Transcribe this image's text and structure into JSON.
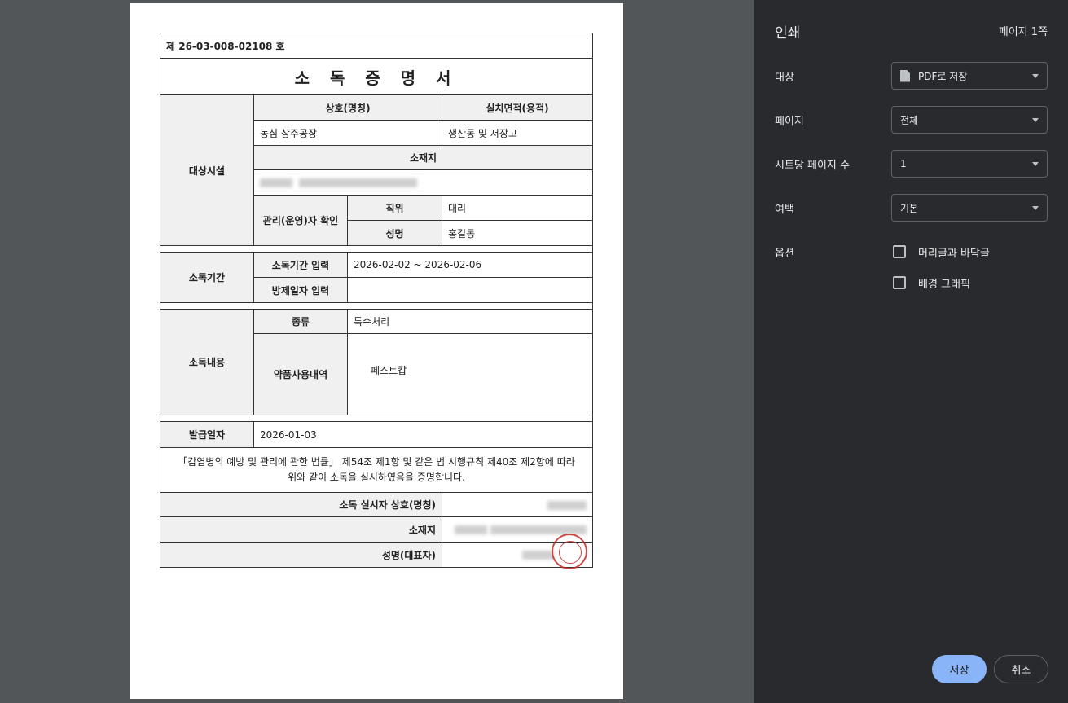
{
  "document": {
    "doc_no": "제 26-03-008-02108 호",
    "title": "소 독 증 명 서",
    "facility_label": "대상시설",
    "name_header": "상호(명칭)",
    "area_header": "실치면적(용적)",
    "name_value": "농심 상주공장",
    "area_value": "생산동 및 저장고",
    "address_header": "소재지",
    "manager_label": "관리(운영)자 확인",
    "position_label": "직위",
    "position_value": "대리",
    "person_label": "성명",
    "person_value": "홍길동",
    "period_label": "소독기간",
    "period_input_label": "소독기간 입력",
    "period_value": "2026-02-02 ~ 2026-02-06",
    "pest_date_label": "방제일자 입력",
    "pest_date_value": "",
    "content_label": "소독내용",
    "type_label": "종류",
    "type_value": "특수처리",
    "chem_label": "약품사용내역",
    "chem_value": "페스트캅",
    "issue_label": "발급일자",
    "issue_value": "2026-01-03",
    "statement_line1": "「감염병의 예방 및 관리에 관한 법률」 제54조 제1항 및 같은 법 시행규칙 제40조 제2항에 따라",
    "statement_line2": "위와 같이 소독을 실시하였음을 증명합니다.",
    "disinfector_name_label": "소독 실시자 상호(명칭)",
    "disinfector_address_label": "소재지",
    "representative_label": "성명(대표자)"
  },
  "panel": {
    "title": "인쇄",
    "page_count": "페이지 1쪽",
    "destination_label": "대상",
    "destination_value": "PDF로 저장",
    "pages_label": "페이지",
    "pages_value": "전체",
    "per_sheet_label": "시트당 페이지 수",
    "per_sheet_value": "1",
    "margins_label": "여백",
    "margins_value": "기본",
    "options_label": "옵션",
    "option_headers_footers": "머리글과 바닥글",
    "option_background": "배경 그래픽",
    "save_label": "저장",
    "cancel_label": "취소"
  }
}
